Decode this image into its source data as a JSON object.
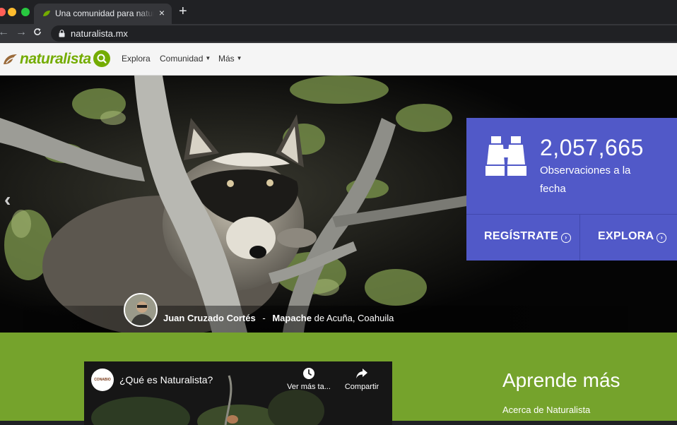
{
  "browser": {
    "tab_title": "Una comunidad para naturalistas",
    "tab_close": "×",
    "new_tab": "+",
    "url": "naturalista.mx",
    "nav_back": "←",
    "nav_forward": "→",
    "reload": "C"
  },
  "header": {
    "logo_text": "naturalista",
    "nav": {
      "explora": "Explora",
      "comunidad": "Comunidad",
      "mas": "Más"
    }
  },
  "hero": {
    "prev_arrow": "‹",
    "caption": {
      "observer": "Juan Cruzado Cortés",
      "separator": "-",
      "species": "Mapache",
      "location": "de Acuña, Coahuila"
    },
    "stats": {
      "count": "2,057,665",
      "label": "Observaciones a la fecha",
      "cta_register": "REGÍSTRATE",
      "cta_explore": "EXPLORA"
    }
  },
  "green_section": {
    "video": {
      "channel_logo": "CONABIO",
      "title": "¿Qué es Naturalista?",
      "watch_later": "Ver más ta...",
      "share": "Compartir"
    },
    "learn_more": {
      "title": "Aprende más",
      "link_about": "Acerca de Naturalista"
    }
  },
  "colors": {
    "brand_green": "#74ac00",
    "stats_purple": "#5159c8",
    "section_green": "#75a32c"
  }
}
